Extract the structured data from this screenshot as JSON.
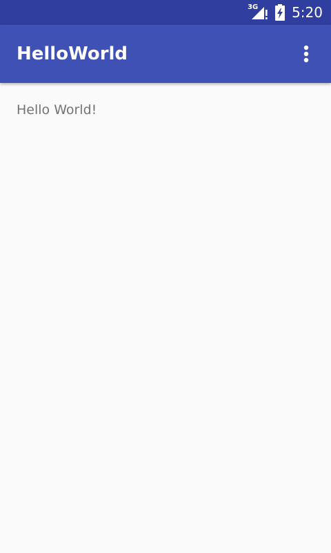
{
  "status_bar": {
    "network_type": "3G",
    "time": "5:20",
    "icons": [
      "network-type-icon",
      "signal-icon",
      "battery-charging-icon"
    ]
  },
  "app_bar": {
    "title": "HelloWorld",
    "overflow_icon": "more-vert-icon"
  },
  "content": {
    "text": "Hello World!"
  },
  "colors": {
    "status_bar": "#303f9f",
    "app_bar": "#3f51b5",
    "background": "#fafafa",
    "body_text": "#737373",
    "on_primary": "#ffffff"
  }
}
